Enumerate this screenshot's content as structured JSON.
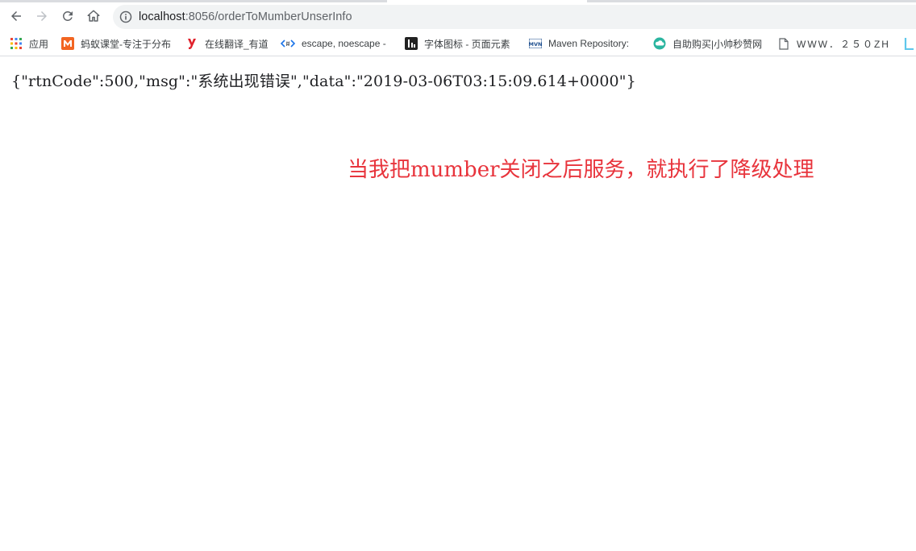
{
  "browser": {
    "address_bar": {
      "host": "localhost",
      "path": ":8056/orderToMumberUnserInfo"
    }
  },
  "bookmarks": [
    {
      "label": "应用",
      "icon": "apps-grid-icon"
    },
    {
      "label": "蚂蚁课堂-专注于分布",
      "icon": "mayi-logo-icon"
    },
    {
      "label": "在线翻译_有道",
      "icon": "youdao-icon"
    },
    {
      "label": "escape, noescape -",
      "icon": "code-tag-icon"
    },
    {
      "label": "字体图标 - 页面元素",
      "icon": "iconfont-icon"
    },
    {
      "label": "Maven Repository:",
      "icon": "mvn-icon"
    },
    {
      "label": "自助购买|小帅秒赞网",
      "icon": "cloud-icon"
    },
    {
      "label": "WWW．２５０ZH",
      "icon": "page-icon"
    }
  ],
  "content": {
    "json_text": "{\"rtnCode\":500,\"msg\":\"系统出现错误\",\"data\":\"2019-03-06T03:15:09.614+0000\"}",
    "annotation": "当我把mumber关闭之后服务，就执行了降级处理"
  },
  "colors": {
    "annotation": "#e8343c",
    "bookmark_mayi": "#f26522",
    "bookmark_youdao": "#e0212b"
  }
}
